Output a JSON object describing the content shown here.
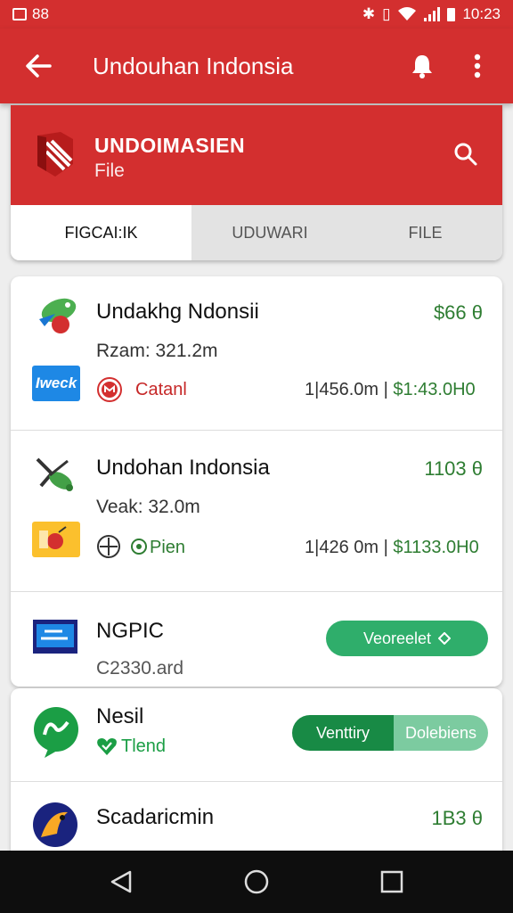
{
  "status_bar": {
    "left_text": "88",
    "time": "10:23",
    "icons": [
      "image-icon",
      "bluetooth-icon",
      "vibrate-icon",
      "wifi-icon",
      "signal-icon",
      "battery-icon"
    ]
  },
  "app_bar": {
    "title": "Undouhan Indonsia",
    "icons": [
      "back-arrow-icon",
      "notification-bell-icon",
      "more-vert-icon"
    ]
  },
  "header": {
    "brand": "UNDOIMASIEN",
    "subtitle": "File",
    "icons": [
      "brand-logo-icon",
      "search-icon"
    ]
  },
  "tabs": [
    {
      "label": "FIGCAI:IK",
      "active": true
    },
    {
      "label": "UDUWARI",
      "active": false
    },
    {
      "label": "FILE",
      "active": false
    }
  ],
  "items": [
    {
      "title": "Undakhg Ndonsii",
      "price": "$66 θ",
      "size": "Rzam: 321.2m",
      "badge": "Iweck",
      "status": "Catanl",
      "meta": "1|456.0m |",
      "amount": "$1:43.0H0",
      "icons": [
        "parrot-icon",
        "cancel-status-icon"
      ]
    },
    {
      "title": "Undohan Indonsia",
      "price": "1103 θ",
      "size": "Veak: 32.0m",
      "status": "Pien",
      "meta": "1|426 0m |",
      "amount": "$1133.0H0",
      "icons": [
        "grasshopper-icon",
        "apple-badge-icon",
        "target-icon",
        "check-circle-icon"
      ]
    },
    {
      "title": "NGPIC",
      "size": "C2330.ard",
      "button_label": "Veoreelet",
      "icons": [
        "video-app-icon",
        "chevron-right-icon"
      ]
    },
    {
      "title": "Nesil",
      "status": "Tlend",
      "seg_left": "Venttiry",
      "seg_right": "Dolebiens",
      "icons": [
        "chat-app-icon",
        "heart-check-icon"
      ]
    },
    {
      "title": "Scadaricmin",
      "price": "1B3 θ",
      "icons": [
        "bird-app-icon"
      ]
    }
  ],
  "nav_bar": {
    "icons": [
      "back-triangle-icon",
      "home-circle-icon",
      "recents-square-icon"
    ]
  },
  "colors": {
    "primary": "#d32f2f",
    "green": "#2e7d32",
    "button_green": "#2fae6b",
    "tab_gray": "#e3e3e3",
    "nav": "#0e0e0e"
  }
}
